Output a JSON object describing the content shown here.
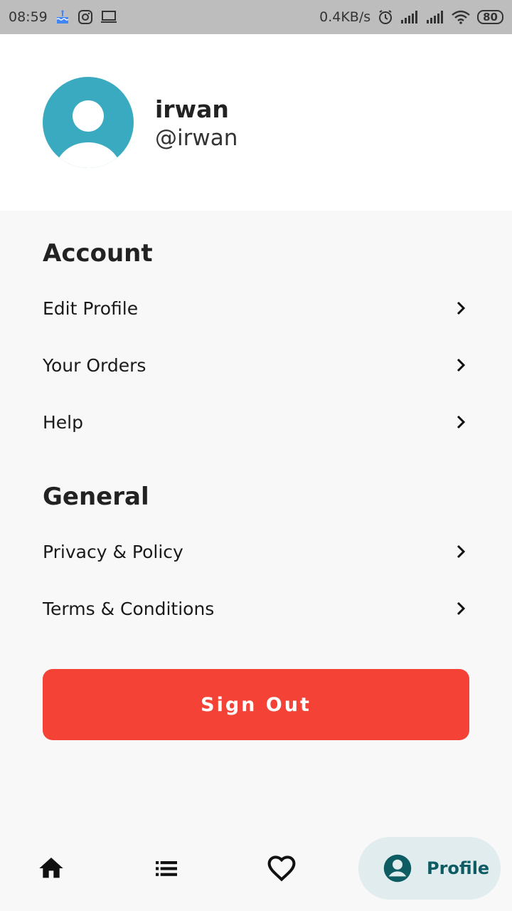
{
  "status_bar": {
    "time": "08:59",
    "net_speed": "0.4KB/s",
    "battery": "80",
    "icons": [
      "cake-icon",
      "instagram-icon",
      "laptop-icon",
      "alarm-icon",
      "signal-icon",
      "signal-icon",
      "wifi-icon",
      "battery-icon"
    ]
  },
  "profile": {
    "name": "irwan",
    "handle": "@irwan"
  },
  "sections": {
    "account_title": "Account",
    "account_items": [
      "Edit Profile",
      "Your Orders",
      "Help"
    ],
    "general_title": "General",
    "general_items": [
      "Privacy & Policy",
      "Terms & Conditions"
    ]
  },
  "sign_out_label": "Sign Out",
  "bottom_nav": {
    "items": [
      "home-icon",
      "list-icon",
      "heart-icon",
      "profile-icon"
    ],
    "active_label": "Profile"
  },
  "colors": {
    "accent": "#f44336",
    "avatar": "#3aaac1",
    "nav_active_bg": "#e0eced",
    "nav_active_fg": "#0e5c63"
  }
}
